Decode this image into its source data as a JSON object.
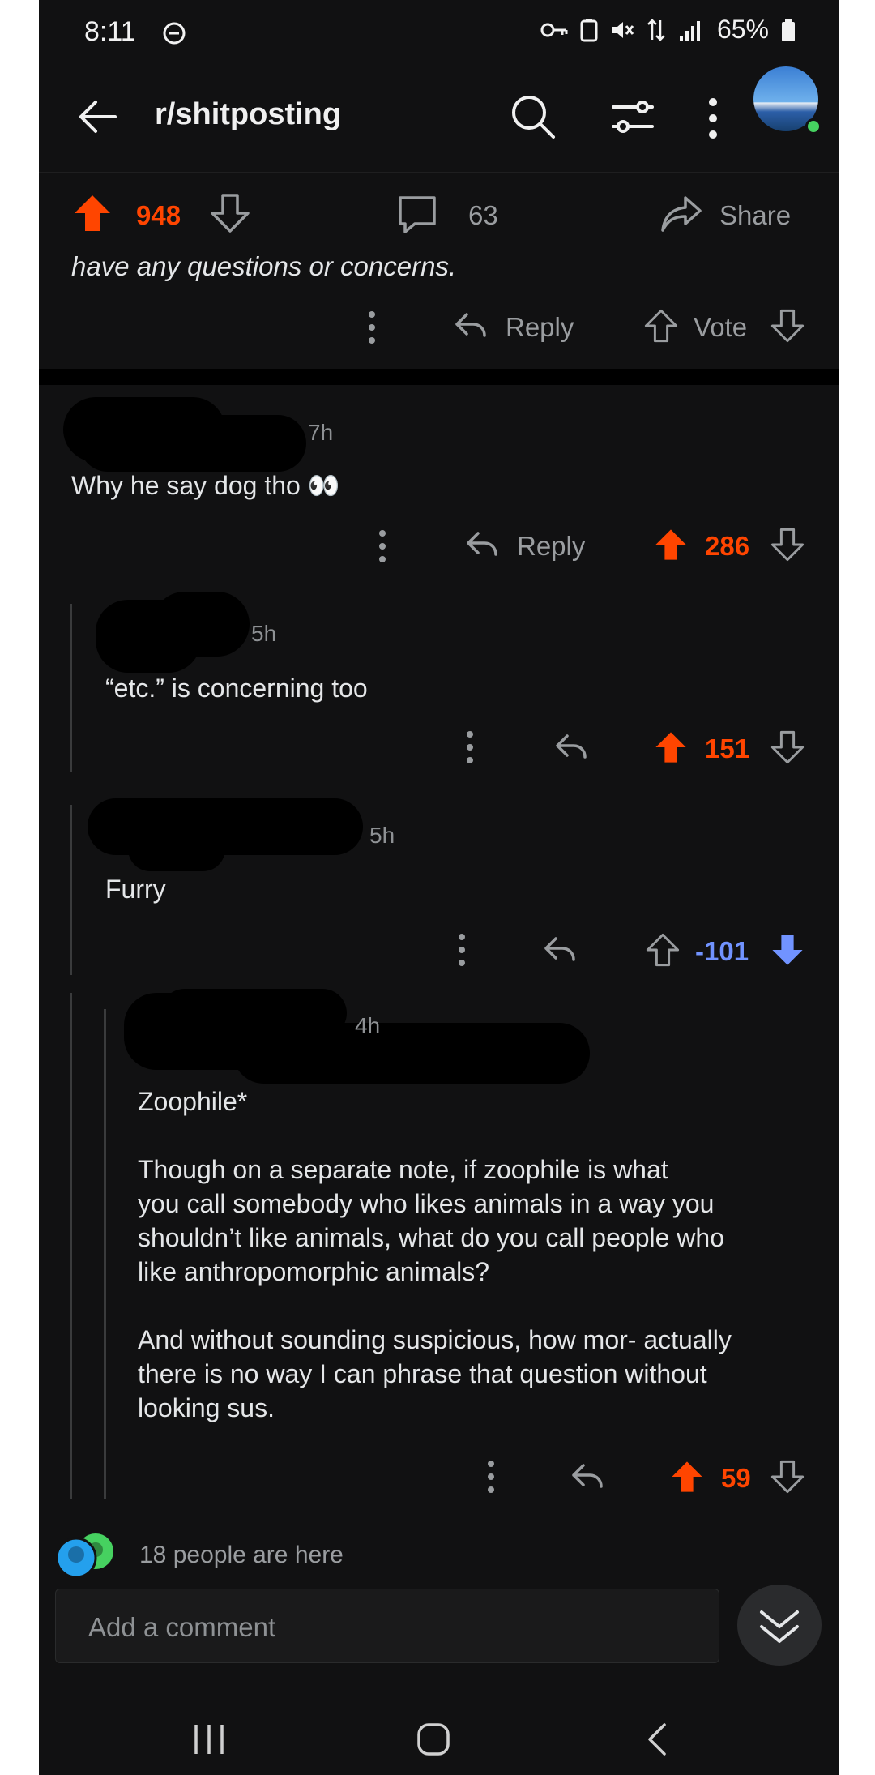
{
  "status_bar": {
    "time": "8:11",
    "battery": "65%"
  },
  "header": {
    "subreddit": "r/shitposting"
  },
  "post": {
    "score": "948",
    "comments": "63",
    "share_label": "Share"
  },
  "comment_tail": {
    "text": "have any questions or concerns.",
    "reply_label": "Reply",
    "vote_label": "Vote"
  },
  "comments": [
    {
      "age": "7h",
      "body": "Why he say dog tho 👀",
      "reply_label": "Reply",
      "score": "286"
    },
    {
      "age": "5h",
      "body": "“etc.” is concerning too",
      "score": "151"
    },
    {
      "age": "5h",
      "body": "Furry",
      "score": "-101"
    },
    {
      "age": "4h",
      "body": "Zoophile*\n\nThough on a separate note, if zoophile is what\nyou call somebody who likes animals in a way you\nshouldn’t like animals, what do you call people who\nlike anthropomorphic animals?\n\nAnd without sounding suspicious, how mor- actually\nthere is no way I can phrase that question without\nlooking sus.",
      "score": "59"
    }
  ],
  "presence": {
    "text": "18 people are here"
  },
  "composer": {
    "placeholder": "Add a comment"
  },
  "colors": {
    "upvote": "#ff4500",
    "downvote": "#7193ff",
    "background": "#111112",
    "online": "#46d160"
  }
}
